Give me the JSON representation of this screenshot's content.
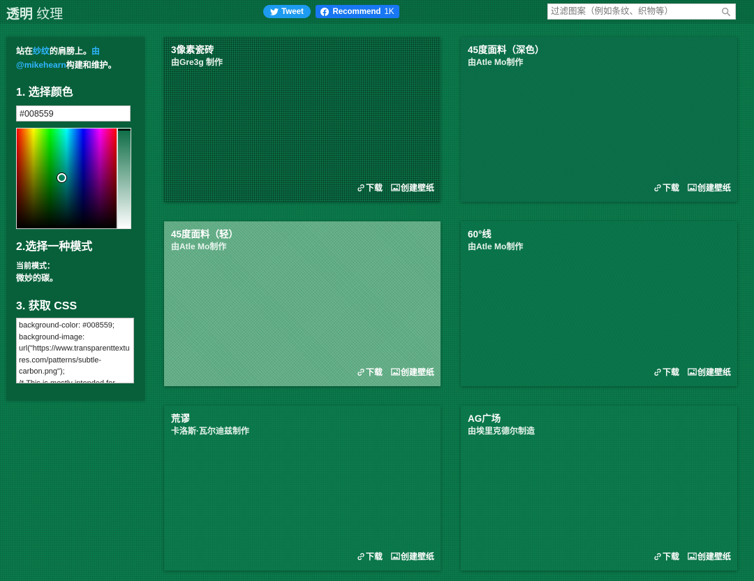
{
  "header": {
    "brand_bold": "透明",
    "brand_light": "纹理",
    "tweet_label": "Tweet",
    "recommend_label": "Recommend",
    "recommend_count": "1K",
    "search_placeholder": "过滤图案（例如条纹、织物等）"
  },
  "sidebar": {
    "intro_prefix": "站在",
    "intro_link": "纱纹",
    "intro_middle": "的肩膀上。",
    "intro_by": "由",
    "intro_author": "@mikehearn",
    "intro_suffix": "构建和维护。",
    "step1_heading": "1. 选择颜色",
    "color_value": "#008559",
    "step2_heading": "2.选择一种模式",
    "current_mode_label": "当前模式：",
    "current_mode_value": "微妙的碳。",
    "step3_heading": "3. 获取 CSS",
    "css_code": "background-color: #008559;\nbackground-image: url(\"https://www.transparenttextures.com/patterns/subtle-carbon.png\");\n/* This is mostly intended for prototyping; please download the pattern and re-host for production environments. Thank you! */"
  },
  "actions": {
    "download": "下载",
    "wallpaper": "创建壁纸"
  },
  "cards": [
    {
      "title": "3像素瓷砖",
      "author": "由Gre3g 制作"
    },
    {
      "title": "45度面料（深色）",
      "author": "由Atle Mo制作"
    },
    {
      "title": "45度面料（轻）",
      "author": "由Atle Mo制作"
    },
    {
      "title": "60°线",
      "author": "由Atle Mo制作"
    },
    {
      "title": "荒谬",
      "author": "卡洛斯·瓦尔迪兹制作"
    },
    {
      "title": "AG广场",
      "author": "由埃里克德尔制造"
    }
  ],
  "icons": {
    "twitter": "twitter-bird-icon",
    "facebook": "facebook-icon",
    "search": "magnifier-icon",
    "download": "link-icon",
    "wallpaper": "image-icon"
  }
}
